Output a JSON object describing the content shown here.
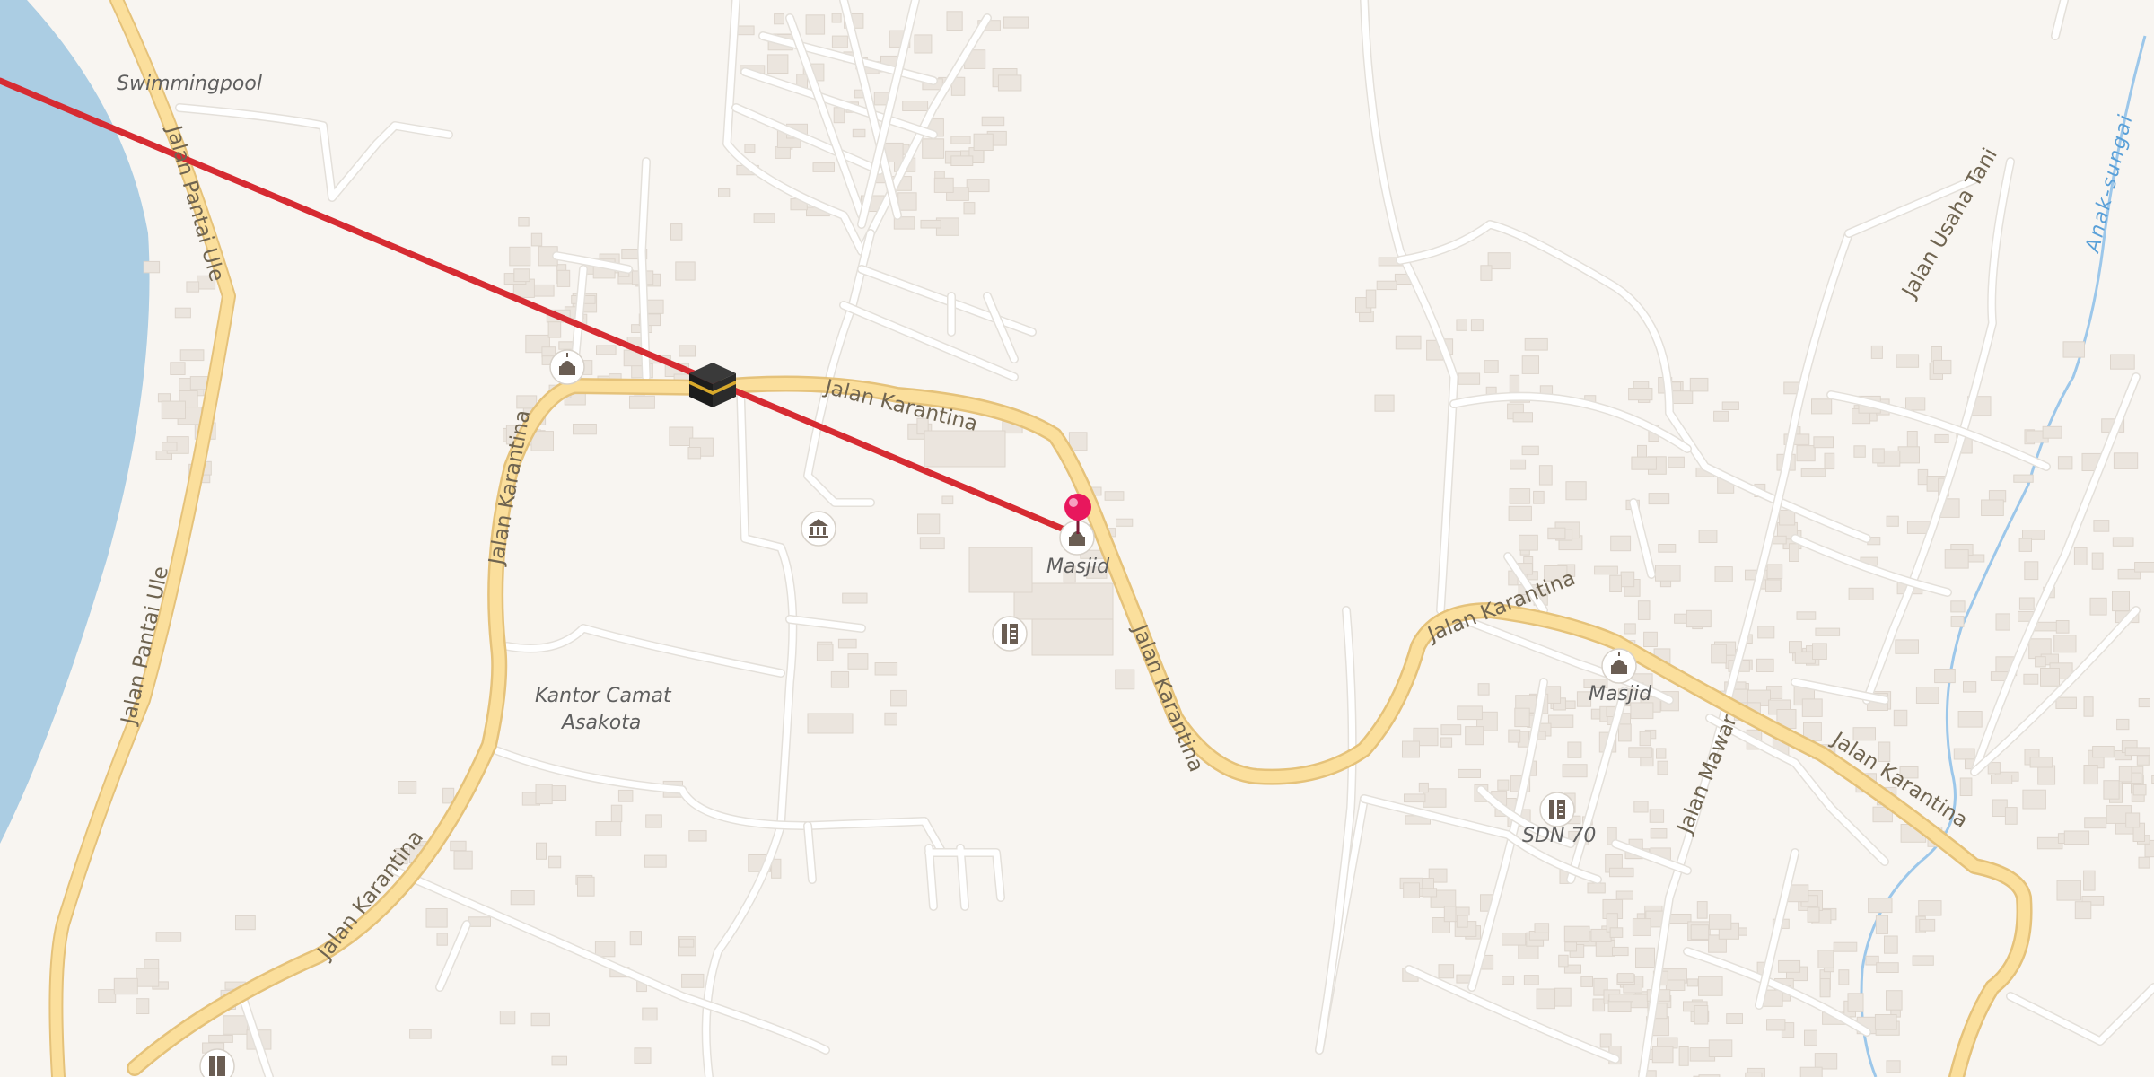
{
  "map": {
    "colors": {
      "land": "#f8f5f1",
      "water": "#abcde3",
      "main_road": "#fbdf9c",
      "minor_road": "#ffffff",
      "route_line": "#d62b32",
      "marker": "#e8175d"
    },
    "route_line": {
      "icon": "kaaba-icon",
      "destination_marker": "pin-marker"
    },
    "road_labels": {
      "karantina_1": "Jalan Karantina",
      "karantina_2": "Jalan Karantina",
      "karantina_3": "Jalan Karantina",
      "karantina_4": "Jalan Karantina",
      "karantina_5": "Jalan Karantina",
      "karantina_6": "Jalan Karantina",
      "pantai_ule_1": "Jalan Pantai Ule",
      "pantai_ule_2": "Jalan Pantai Ule",
      "usaha_tani": "Jalan Usaha Tani",
      "mawar": "Jalan Mawar"
    },
    "water_label": "Anak-sungai",
    "places": {
      "swimmingpool": "Swimmingpool",
      "masjid_1": "Masjid",
      "masjid_2": "Masjid",
      "kantor_line1": "Kantor Camat",
      "kantor_line2": "Asakota",
      "sdn": "SDN 70"
    },
    "poi_icons": [
      "mosque-icon",
      "museum-icon",
      "school-icon"
    ]
  }
}
